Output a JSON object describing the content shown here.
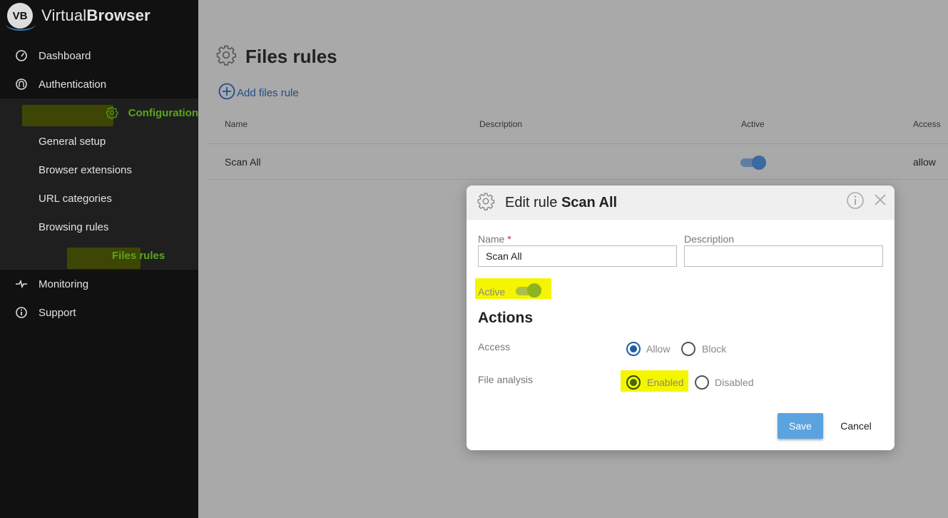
{
  "app": {
    "logo_badge": "VB",
    "name_light": "Virtual",
    "name_bold": "Browser"
  },
  "sidebar": {
    "items": [
      {
        "label": "Dashboard",
        "icon": "gauge-icon"
      },
      {
        "label": "Authentication",
        "icon": "fingerprint-icon"
      },
      {
        "label": "Configuration",
        "icon": "gear-icon",
        "active": true
      },
      {
        "label": "Monitoring",
        "icon": "pulse-icon"
      },
      {
        "label": "Support",
        "icon": "info-icon"
      }
    ],
    "config_subitems": [
      {
        "label": "General setup"
      },
      {
        "label": "Browser extensions"
      },
      {
        "label": "URL categories"
      },
      {
        "label": "Browsing rules"
      },
      {
        "label": "Files rules",
        "active": true
      }
    ]
  },
  "main": {
    "title": "Files rules",
    "add_button": "Add files rule",
    "table": {
      "columns": [
        "Name",
        "Description",
        "Active",
        "Access"
      ],
      "rows": [
        {
          "name": "Scan All",
          "description": "",
          "active": true,
          "access": "allow"
        }
      ]
    }
  },
  "modal": {
    "title_prefix": "Edit rule",
    "title_name": "Scan All",
    "name_label": "Name",
    "required_mark": "*",
    "name_value": "Scan All",
    "description_label": "Description",
    "description_value": "",
    "active_label": "Active",
    "active": true,
    "actions_title": "Actions",
    "access_label": "Access",
    "access_options": [
      "Allow",
      "Block"
    ],
    "access_selected": "Allow",
    "file_analysis_label": "File analysis",
    "file_analysis_options": [
      "Enabled",
      "Disabled"
    ],
    "file_analysis_selected": "Enabled",
    "save_label": "Save",
    "cancel_label": "Cancel"
  },
  "colors": {
    "sidebar_bg": "#111111",
    "active_green": "#5aa61a",
    "link_blue": "#1e4f8c",
    "save_blue": "#5aa3df",
    "highlight_yellow": "#f5f500"
  }
}
